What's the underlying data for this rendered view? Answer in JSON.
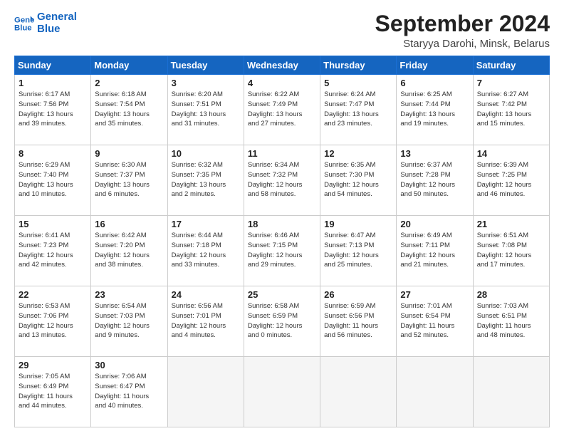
{
  "header": {
    "logo_line1": "General",
    "logo_line2": "Blue",
    "title": "September 2024",
    "subtitle": "Staryya Darohi, Minsk, Belarus"
  },
  "weekdays": [
    "Sunday",
    "Monday",
    "Tuesday",
    "Wednesday",
    "Thursday",
    "Friday",
    "Saturday"
  ],
  "rows": [
    [
      {
        "day": "1",
        "lines": [
          "Sunrise: 6:17 AM",
          "Sunset: 7:56 PM",
          "Daylight: 13 hours",
          "and 39 minutes."
        ]
      },
      {
        "day": "2",
        "lines": [
          "Sunrise: 6:18 AM",
          "Sunset: 7:54 PM",
          "Daylight: 13 hours",
          "and 35 minutes."
        ]
      },
      {
        "day": "3",
        "lines": [
          "Sunrise: 6:20 AM",
          "Sunset: 7:51 PM",
          "Daylight: 13 hours",
          "and 31 minutes."
        ]
      },
      {
        "day": "4",
        "lines": [
          "Sunrise: 6:22 AM",
          "Sunset: 7:49 PM",
          "Daylight: 13 hours",
          "and 27 minutes."
        ]
      },
      {
        "day": "5",
        "lines": [
          "Sunrise: 6:24 AM",
          "Sunset: 7:47 PM",
          "Daylight: 13 hours",
          "and 23 minutes."
        ]
      },
      {
        "day": "6",
        "lines": [
          "Sunrise: 6:25 AM",
          "Sunset: 7:44 PM",
          "Daylight: 13 hours",
          "and 19 minutes."
        ]
      },
      {
        "day": "7",
        "lines": [
          "Sunrise: 6:27 AM",
          "Sunset: 7:42 PM",
          "Daylight: 13 hours",
          "and 15 minutes."
        ]
      }
    ],
    [
      {
        "day": "8",
        "lines": [
          "Sunrise: 6:29 AM",
          "Sunset: 7:40 PM",
          "Daylight: 13 hours",
          "and 10 minutes."
        ]
      },
      {
        "day": "9",
        "lines": [
          "Sunrise: 6:30 AM",
          "Sunset: 7:37 PM",
          "Daylight: 13 hours",
          "and 6 minutes."
        ]
      },
      {
        "day": "10",
        "lines": [
          "Sunrise: 6:32 AM",
          "Sunset: 7:35 PM",
          "Daylight: 13 hours",
          "and 2 minutes."
        ]
      },
      {
        "day": "11",
        "lines": [
          "Sunrise: 6:34 AM",
          "Sunset: 7:32 PM",
          "Daylight: 12 hours",
          "and 58 minutes."
        ]
      },
      {
        "day": "12",
        "lines": [
          "Sunrise: 6:35 AM",
          "Sunset: 7:30 PM",
          "Daylight: 12 hours",
          "and 54 minutes."
        ]
      },
      {
        "day": "13",
        "lines": [
          "Sunrise: 6:37 AM",
          "Sunset: 7:28 PM",
          "Daylight: 12 hours",
          "and 50 minutes."
        ]
      },
      {
        "day": "14",
        "lines": [
          "Sunrise: 6:39 AM",
          "Sunset: 7:25 PM",
          "Daylight: 12 hours",
          "and 46 minutes."
        ]
      }
    ],
    [
      {
        "day": "15",
        "lines": [
          "Sunrise: 6:41 AM",
          "Sunset: 7:23 PM",
          "Daylight: 12 hours",
          "and 42 minutes."
        ]
      },
      {
        "day": "16",
        "lines": [
          "Sunrise: 6:42 AM",
          "Sunset: 7:20 PM",
          "Daylight: 12 hours",
          "and 38 minutes."
        ]
      },
      {
        "day": "17",
        "lines": [
          "Sunrise: 6:44 AM",
          "Sunset: 7:18 PM",
          "Daylight: 12 hours",
          "and 33 minutes."
        ]
      },
      {
        "day": "18",
        "lines": [
          "Sunrise: 6:46 AM",
          "Sunset: 7:15 PM",
          "Daylight: 12 hours",
          "and 29 minutes."
        ]
      },
      {
        "day": "19",
        "lines": [
          "Sunrise: 6:47 AM",
          "Sunset: 7:13 PM",
          "Daylight: 12 hours",
          "and 25 minutes."
        ]
      },
      {
        "day": "20",
        "lines": [
          "Sunrise: 6:49 AM",
          "Sunset: 7:11 PM",
          "Daylight: 12 hours",
          "and 21 minutes."
        ]
      },
      {
        "day": "21",
        "lines": [
          "Sunrise: 6:51 AM",
          "Sunset: 7:08 PM",
          "Daylight: 12 hours",
          "and 17 minutes."
        ]
      }
    ],
    [
      {
        "day": "22",
        "lines": [
          "Sunrise: 6:53 AM",
          "Sunset: 7:06 PM",
          "Daylight: 12 hours",
          "and 13 minutes."
        ]
      },
      {
        "day": "23",
        "lines": [
          "Sunrise: 6:54 AM",
          "Sunset: 7:03 PM",
          "Daylight: 12 hours",
          "and 9 minutes."
        ]
      },
      {
        "day": "24",
        "lines": [
          "Sunrise: 6:56 AM",
          "Sunset: 7:01 PM",
          "Daylight: 12 hours",
          "and 4 minutes."
        ]
      },
      {
        "day": "25",
        "lines": [
          "Sunrise: 6:58 AM",
          "Sunset: 6:59 PM",
          "Daylight: 12 hours",
          "and 0 minutes."
        ]
      },
      {
        "day": "26",
        "lines": [
          "Sunrise: 6:59 AM",
          "Sunset: 6:56 PM",
          "Daylight: 11 hours",
          "and 56 minutes."
        ]
      },
      {
        "day": "27",
        "lines": [
          "Sunrise: 7:01 AM",
          "Sunset: 6:54 PM",
          "Daylight: 11 hours",
          "and 52 minutes."
        ]
      },
      {
        "day": "28",
        "lines": [
          "Sunrise: 7:03 AM",
          "Sunset: 6:51 PM",
          "Daylight: 11 hours",
          "and 48 minutes."
        ]
      }
    ],
    [
      {
        "day": "29",
        "lines": [
          "Sunrise: 7:05 AM",
          "Sunset: 6:49 PM",
          "Daylight: 11 hours",
          "and 44 minutes."
        ]
      },
      {
        "day": "30",
        "lines": [
          "Sunrise: 7:06 AM",
          "Sunset: 6:47 PM",
          "Daylight: 11 hours",
          "and 40 minutes."
        ]
      },
      {
        "day": "",
        "lines": [],
        "empty": true
      },
      {
        "day": "",
        "lines": [],
        "empty": true
      },
      {
        "day": "",
        "lines": [],
        "empty": true
      },
      {
        "day": "",
        "lines": [],
        "empty": true
      },
      {
        "day": "",
        "lines": [],
        "empty": true
      }
    ]
  ]
}
